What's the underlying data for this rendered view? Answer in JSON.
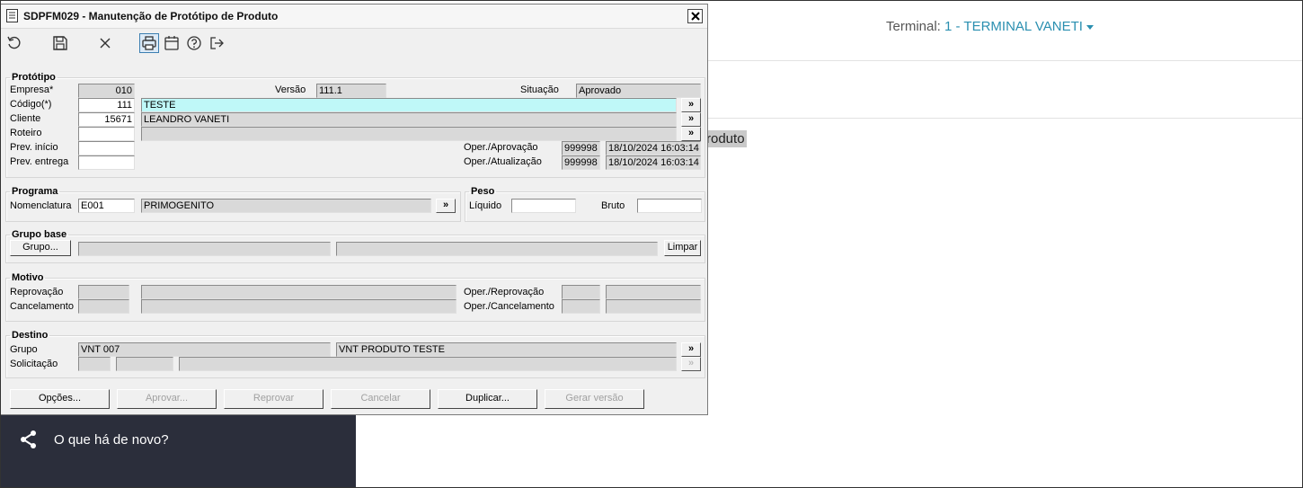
{
  "topbar": {
    "terminal_label": "Terminal:",
    "terminal_value": "1 - TERMINAL VANETI"
  },
  "background": {
    "partial_text": "roduto"
  },
  "sidebar": {
    "whats_new": "O que há de novo?"
  },
  "window": {
    "title": "SDPFM029 - Manutenção de Protótipo de Produto",
    "toolbar_icons": [
      "undo-icon",
      "save-icon",
      "cancel-icon",
      "print-icon",
      "calendar-icon",
      "help-icon",
      "exit-icon"
    ],
    "prototipo": {
      "legend": "Protótipo",
      "empresa_label": "Empresa*",
      "empresa_value": "010",
      "versao_label": "Versão",
      "versao_value": "111.1",
      "situacao_label": "Situação",
      "situacao_value": "Aprovado",
      "codigo_label": "Código(*)",
      "codigo_value": "111",
      "codigo_desc": "TESTE",
      "cliente_label": "Cliente",
      "cliente_value": "15671",
      "cliente_desc": "LEANDRO VANETI",
      "roteiro_label": "Roteiro",
      "roteiro_value": "",
      "roteiro_desc": "",
      "prev_inicio_label": "Prev. início",
      "prev_inicio_value": "",
      "prev_entrega_label": "Prev. entrega",
      "prev_entrega_value": "",
      "oper_aprov_label": "Oper./Aprovação",
      "oper_aprov_user": "999998",
      "oper_aprov_date": "18/10/2024 16:03:14",
      "oper_atual_label": "Oper./Atualização",
      "oper_atual_user": "999998",
      "oper_atual_date": "18/10/2024 16:03:14"
    },
    "programa": {
      "legend": "Programa",
      "nomenclatura_label": "Nomenclatura",
      "nomenclatura_value": "E001",
      "nomenclatura_desc": "PRIMOGENITO"
    },
    "peso": {
      "legend": "Peso",
      "liquido_label": "Líquido",
      "liquido_value": "",
      "bruto_label": "Bruto",
      "bruto_value": ""
    },
    "grupo_base": {
      "legend": "Grupo base",
      "grupo_button": "Grupo...",
      "field1": "",
      "field2": "",
      "limpar_button": "Limpar"
    },
    "motivo": {
      "legend": "Motivo",
      "reprovacao_label": "Reprovação",
      "cancelamento_label": "Cancelamento",
      "oper_reprov_label": "Oper./Reprovação",
      "oper_cancel_label": "Oper./Cancelamento"
    },
    "destino": {
      "legend": "Destino",
      "grupo_label": "Grupo",
      "grupo_value": "VNT 007",
      "grupo_desc": "VNT PRODUTO TESTE",
      "solicitacao_label": "Solicitação"
    },
    "arrow_symbol": "»",
    "buttons": {
      "opcoes": "Opções...",
      "aprovar": "Aprovar...",
      "reprovar": "Reprovar",
      "cancelar": "Cancelar",
      "duplicar": "Duplicar...",
      "gerar_versao": "Gerar versão"
    }
  }
}
